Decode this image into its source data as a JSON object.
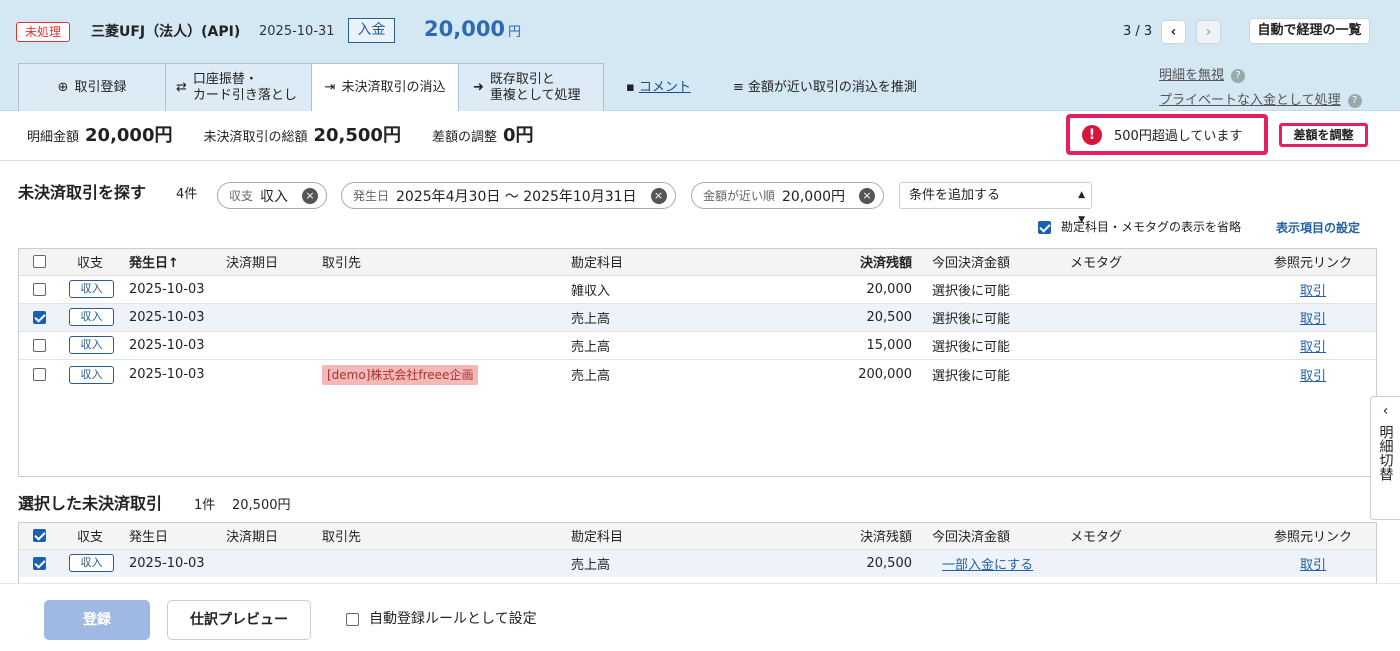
{
  "header": {
    "status": "未処理",
    "bank": "三菱UFJ（法人）(API)",
    "date": "2025-10-31",
    "direction": "入金",
    "amount": "20,000",
    "currency": "円",
    "pager": "3 / 3",
    "auto_button": "自動で経理の一覧"
  },
  "tabs": [
    {
      "label": "取引登録"
    },
    {
      "label": "口座振替・\nカード引き落とし"
    },
    {
      "label": "未決済取引の消込"
    },
    {
      "label": "既存取引と\n重複として処理"
    }
  ],
  "comment_link": "コメント",
  "guess_link": "金額が近い取引の消込を推測",
  "ignore_link": "明細を無視",
  "private_link": "プライベートな入金として処理",
  "summary": {
    "detail_label": "明細金額",
    "detail_value": "20,000円",
    "total_label": "未決済取引の総額",
    "total_value": "20,500円",
    "adjust_label": "差額の調整",
    "adjust_value": "0円"
  },
  "warning": "500円超過しています",
  "adjust_button": "差額を調整",
  "search": {
    "title": "未決済取引を探す",
    "count": "4件",
    "chips": [
      {
        "key": "収支",
        "value": "収入"
      },
      {
        "key": "発生日",
        "value": "2025年4月30日 〜 2025年10月31日"
      },
      {
        "key": "金額が近い順",
        "value": "20,000円"
      }
    ],
    "add_condition": "条件を追加する",
    "omit_label": "勘定科目・メモタグの表示を省略",
    "settings_link": "表示項目の設定"
  },
  "columns": [
    "収支",
    "発生日↑",
    "決済期日",
    "取引先",
    "勘定科目",
    "決済残額",
    "今回決済金額",
    "メモタグ",
    "参照元リンク"
  ],
  "rows": [
    {
      "type": "収入",
      "date": "2025-10-03",
      "due": "",
      "partner": "",
      "account": "雑収入",
      "balance": "20,000",
      "pay": "選択後に可能",
      "memo": "",
      "ref": "取引",
      "checked": false
    },
    {
      "type": "収入",
      "date": "2025-10-03",
      "due": "",
      "partner": "",
      "account": "売上高",
      "balance": "20,500",
      "pay": "選択後に可能",
      "memo": "",
      "ref": "取引",
      "checked": true
    },
    {
      "type": "収入",
      "date": "2025-10-03",
      "due": "",
      "partner": "",
      "account": "売上高",
      "balance": "15,000",
      "pay": "選択後に可能",
      "memo": "",
      "ref": "取引",
      "checked": false
    },
    {
      "type": "収入",
      "date": "2025-10-03",
      "due": "",
      "partner": "[demo]株式会社freee企画",
      "account": "売上高",
      "balance": "200,000",
      "pay": "選択後に可能",
      "memo": "",
      "ref": "取引",
      "checked": false
    }
  ],
  "selected": {
    "title": "選択した未決済取引",
    "count": "1件",
    "total": "20,500円",
    "columns": [
      "収支",
      "発生日",
      "決済期日",
      "取引先",
      "勘定科目",
      "決済残額",
      "今回決済金額",
      "メモタグ",
      "参照元リンク"
    ],
    "row": {
      "type": "収入",
      "date": "2025-10-03",
      "account": "売上高",
      "balance": "20,500",
      "pay": "一部入金にする",
      "ref": "取引"
    }
  },
  "side_tab": "明細切替",
  "footer": {
    "register": "登録",
    "preview": "仕訳プレビュー",
    "rule": "自動登録ルールとして設定"
  }
}
